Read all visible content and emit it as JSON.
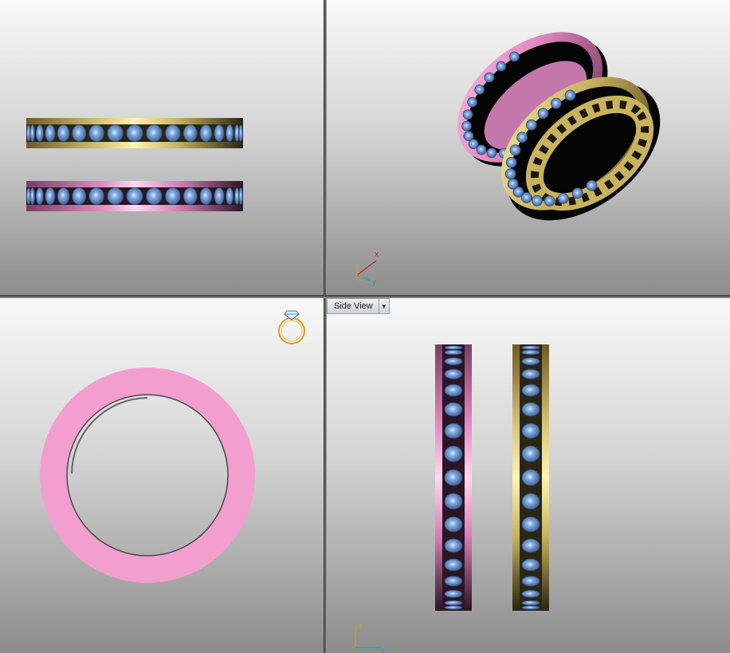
{
  "viewports": {
    "top_left": {
      "name": "front-view"
    },
    "top_right": {
      "name": "perspective-view",
      "axis": {
        "x": "x",
        "y": "y",
        "z": "z"
      }
    },
    "bottom_left": {
      "name": "top-view",
      "icon": "ring-icon"
    },
    "bottom_right": {
      "name": "side-view",
      "label": "Side View",
      "dropdown_icon": "chevron-down-icon",
      "axis": {
        "z": "z",
        "y": "y"
      }
    }
  },
  "colors": {
    "gold": "#c8b25e",
    "rose": "#e79ac9",
    "gem": "#6f96d0",
    "background_top": "#f9f9f9",
    "background_bottom": "#8c8c8c"
  }
}
